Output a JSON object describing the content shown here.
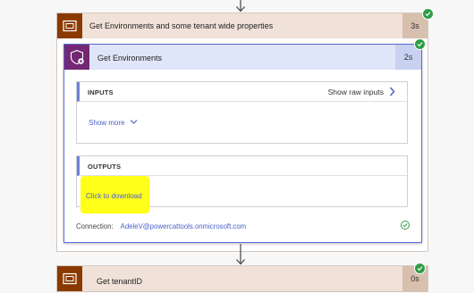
{
  "scope": {
    "title": "Get Environments and some tenant wide properties",
    "duration": "3s"
  },
  "action": {
    "title": "Get Environments",
    "duration": "2s",
    "inputs": {
      "label": "INPUTS",
      "show_raw_label": "Show raw inputs",
      "show_more_label": "Show more"
    },
    "outputs": {
      "label": "OUTPUTS",
      "download_label": "Click to download"
    },
    "connection": {
      "label": "Connection:",
      "value": "AdeleV@powercattools.onmicrosoft.com"
    }
  },
  "next_step": {
    "title": "Get tenantID",
    "duration": "0s"
  },
  "colors": {
    "scope_accent": "#8a3a00",
    "action_accent": "#742774",
    "success": "#2e9e44",
    "link": "#4a62c9",
    "highlight": "#ffff1a"
  },
  "icons": {
    "scope": "scope-icon",
    "action": "shield-gear-icon",
    "status": "checkmark-icon"
  }
}
